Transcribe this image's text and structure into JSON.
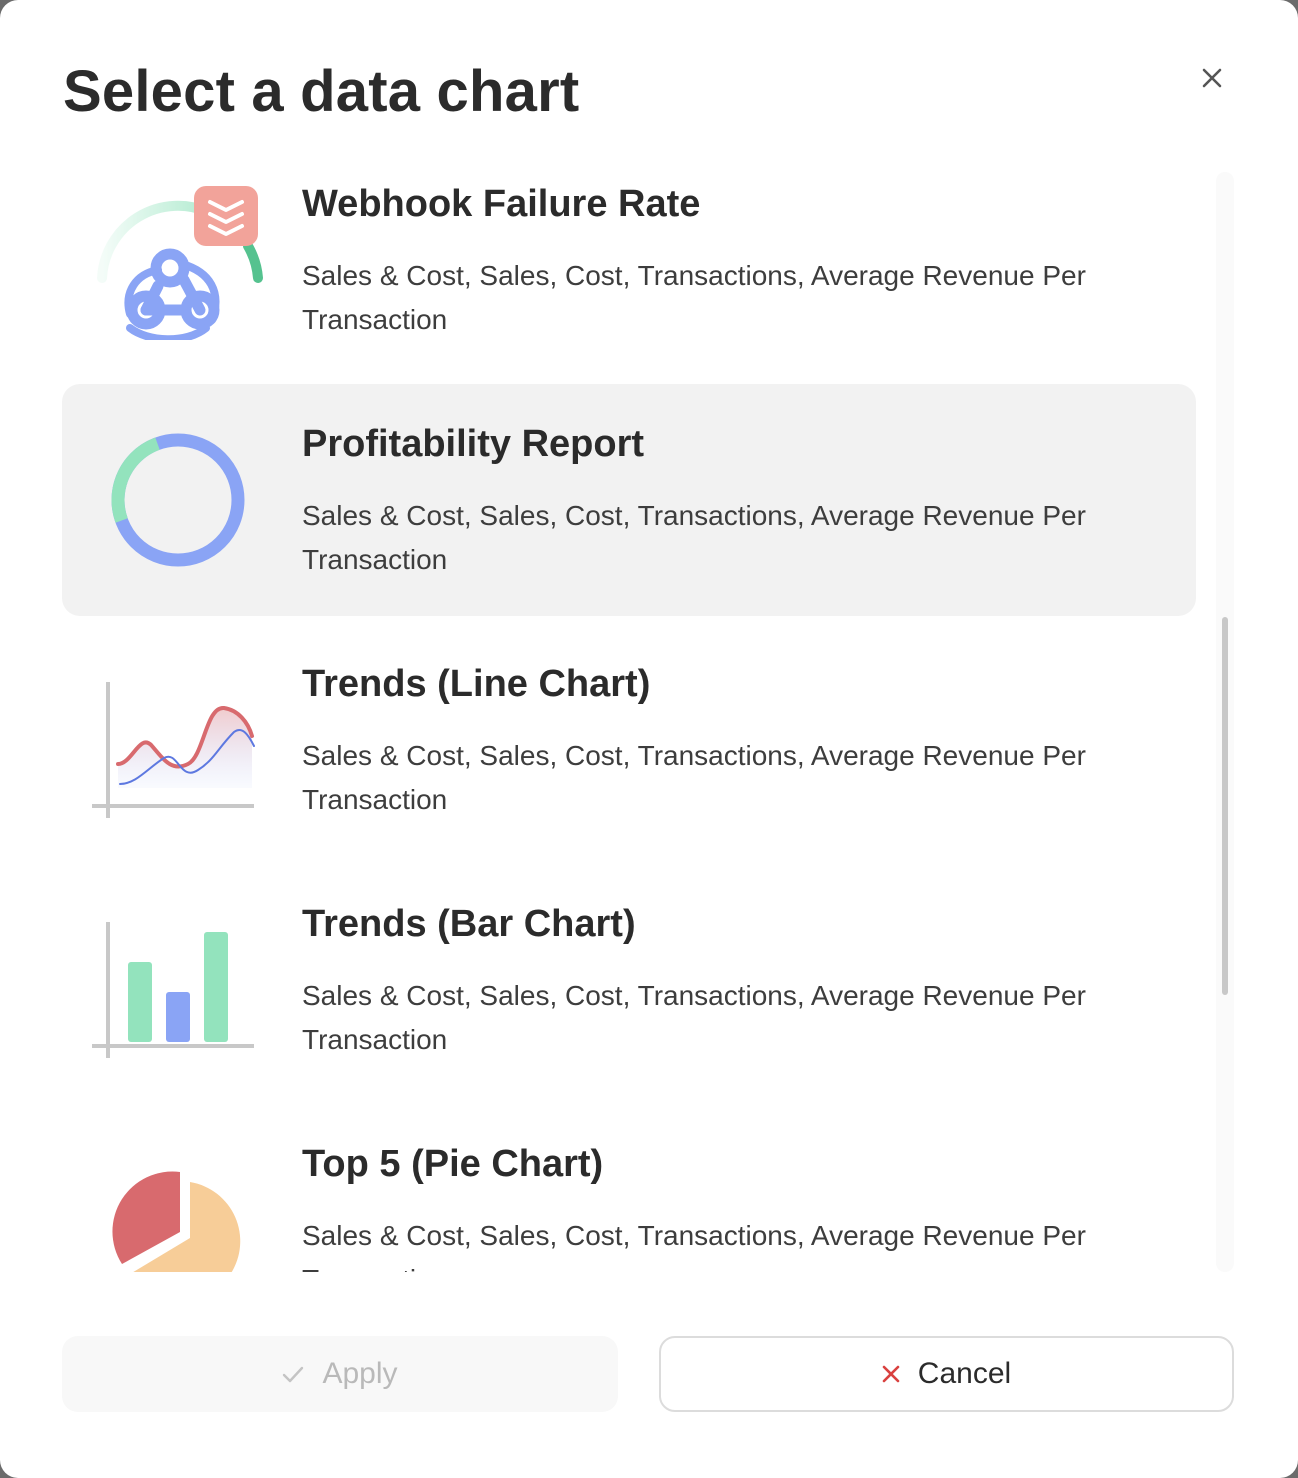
{
  "dialog": {
    "title": "Select a data chart",
    "close_icon": "close-icon"
  },
  "charts": [
    {
      "title": "Webhook Failure Rate",
      "description": "Sales & Cost, Sales, Cost, Transactions, Average Revenue Per Transaction",
      "icon": "webhook-gauge-icon",
      "selected": false
    },
    {
      "title": "Profitability Report",
      "description": "Sales & Cost, Sales, Cost, Transactions, Average Revenue Per Transaction",
      "icon": "donut-chart-icon",
      "selected": true
    },
    {
      "title": "Trends (Line Chart)",
      "description": "Sales & Cost, Sales, Cost, Transactions, Average Revenue Per Transaction",
      "icon": "line-chart-icon",
      "selected": false
    },
    {
      "title": "Trends (Bar Chart)",
      "description": "Sales & Cost, Sales, Cost, Transactions, Average Revenue Per Transaction",
      "icon": "bar-chart-icon",
      "selected": false
    },
    {
      "title": "Top 5 (Pie Chart)",
      "description": "Sales & Cost, Sales, Cost, Transactions, Average Revenue Per Transaction",
      "icon": "pie-chart-icon",
      "selected": false
    }
  ],
  "footer": {
    "apply_label": "Apply",
    "apply_icon": "check-icon",
    "cancel_label": "Cancel",
    "cancel_icon": "close-icon"
  },
  "colors": {
    "green": "#93e3bd",
    "blue": "#8aa4f5",
    "red": "#d86a6e",
    "salmon": "#f2a39a",
    "peach": "#f7cd98",
    "selected_bg": "#f2f2f2"
  }
}
